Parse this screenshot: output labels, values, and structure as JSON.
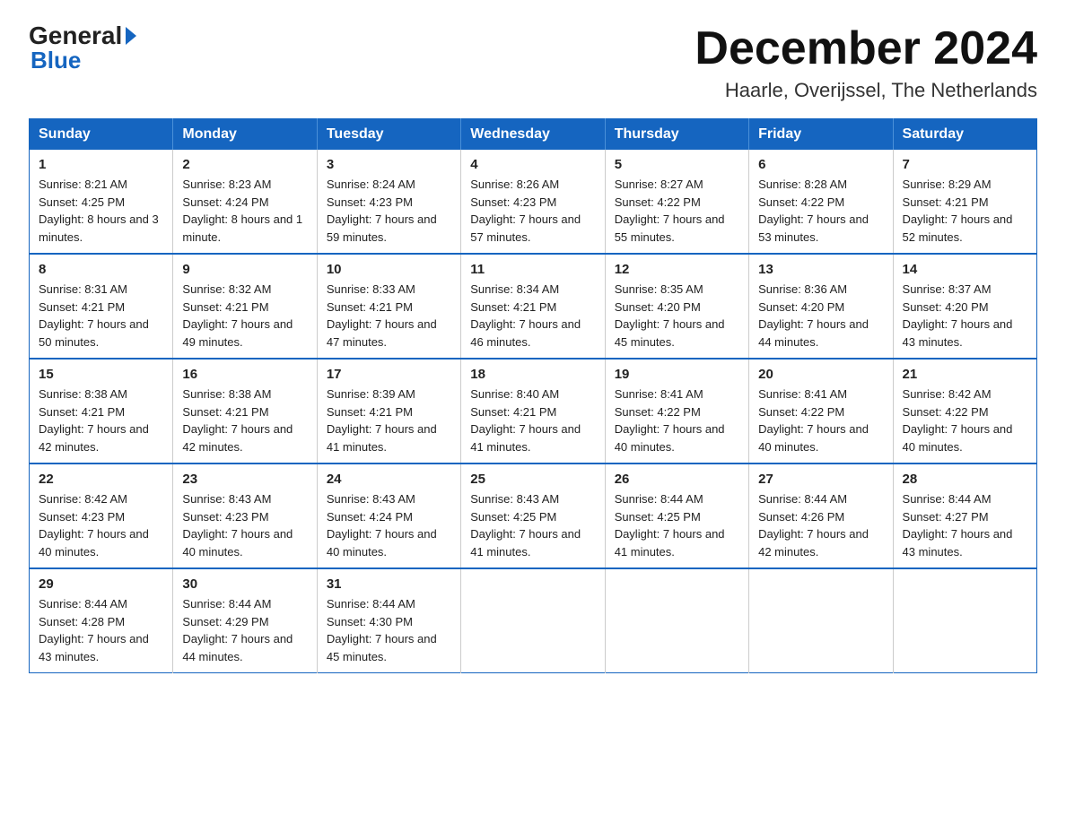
{
  "logo": {
    "general": "General",
    "blue": "Blue"
  },
  "title": "December 2024",
  "location": "Haarle, Overijssel, The Netherlands",
  "days_of_week": [
    "Sunday",
    "Monday",
    "Tuesday",
    "Wednesday",
    "Thursday",
    "Friday",
    "Saturday"
  ],
  "weeks": [
    [
      {
        "day": "1",
        "sunrise": "8:21 AM",
        "sunset": "4:25 PM",
        "daylight": "8 hours and 3 minutes."
      },
      {
        "day": "2",
        "sunrise": "8:23 AM",
        "sunset": "4:24 PM",
        "daylight": "8 hours and 1 minute."
      },
      {
        "day": "3",
        "sunrise": "8:24 AM",
        "sunset": "4:23 PM",
        "daylight": "7 hours and 59 minutes."
      },
      {
        "day": "4",
        "sunrise": "8:26 AM",
        "sunset": "4:23 PM",
        "daylight": "7 hours and 57 minutes."
      },
      {
        "day": "5",
        "sunrise": "8:27 AM",
        "sunset": "4:22 PM",
        "daylight": "7 hours and 55 minutes."
      },
      {
        "day": "6",
        "sunrise": "8:28 AM",
        "sunset": "4:22 PM",
        "daylight": "7 hours and 53 minutes."
      },
      {
        "day": "7",
        "sunrise": "8:29 AM",
        "sunset": "4:21 PM",
        "daylight": "7 hours and 52 minutes."
      }
    ],
    [
      {
        "day": "8",
        "sunrise": "8:31 AM",
        "sunset": "4:21 PM",
        "daylight": "7 hours and 50 minutes."
      },
      {
        "day": "9",
        "sunrise": "8:32 AM",
        "sunset": "4:21 PM",
        "daylight": "7 hours and 49 minutes."
      },
      {
        "day": "10",
        "sunrise": "8:33 AM",
        "sunset": "4:21 PM",
        "daylight": "7 hours and 47 minutes."
      },
      {
        "day": "11",
        "sunrise": "8:34 AM",
        "sunset": "4:21 PM",
        "daylight": "7 hours and 46 minutes."
      },
      {
        "day": "12",
        "sunrise": "8:35 AM",
        "sunset": "4:20 PM",
        "daylight": "7 hours and 45 minutes."
      },
      {
        "day": "13",
        "sunrise": "8:36 AM",
        "sunset": "4:20 PM",
        "daylight": "7 hours and 44 minutes."
      },
      {
        "day": "14",
        "sunrise": "8:37 AM",
        "sunset": "4:20 PM",
        "daylight": "7 hours and 43 minutes."
      }
    ],
    [
      {
        "day": "15",
        "sunrise": "8:38 AM",
        "sunset": "4:21 PM",
        "daylight": "7 hours and 42 minutes."
      },
      {
        "day": "16",
        "sunrise": "8:38 AM",
        "sunset": "4:21 PM",
        "daylight": "7 hours and 42 minutes."
      },
      {
        "day": "17",
        "sunrise": "8:39 AM",
        "sunset": "4:21 PM",
        "daylight": "7 hours and 41 minutes."
      },
      {
        "day": "18",
        "sunrise": "8:40 AM",
        "sunset": "4:21 PM",
        "daylight": "7 hours and 41 minutes."
      },
      {
        "day": "19",
        "sunrise": "8:41 AM",
        "sunset": "4:22 PM",
        "daylight": "7 hours and 40 minutes."
      },
      {
        "day": "20",
        "sunrise": "8:41 AM",
        "sunset": "4:22 PM",
        "daylight": "7 hours and 40 minutes."
      },
      {
        "day": "21",
        "sunrise": "8:42 AM",
        "sunset": "4:22 PM",
        "daylight": "7 hours and 40 minutes."
      }
    ],
    [
      {
        "day": "22",
        "sunrise": "8:42 AM",
        "sunset": "4:23 PM",
        "daylight": "7 hours and 40 minutes."
      },
      {
        "day": "23",
        "sunrise": "8:43 AM",
        "sunset": "4:23 PM",
        "daylight": "7 hours and 40 minutes."
      },
      {
        "day": "24",
        "sunrise": "8:43 AM",
        "sunset": "4:24 PM",
        "daylight": "7 hours and 40 minutes."
      },
      {
        "day": "25",
        "sunrise": "8:43 AM",
        "sunset": "4:25 PM",
        "daylight": "7 hours and 41 minutes."
      },
      {
        "day": "26",
        "sunrise": "8:44 AM",
        "sunset": "4:25 PM",
        "daylight": "7 hours and 41 minutes."
      },
      {
        "day": "27",
        "sunrise": "8:44 AM",
        "sunset": "4:26 PM",
        "daylight": "7 hours and 42 minutes."
      },
      {
        "day": "28",
        "sunrise": "8:44 AM",
        "sunset": "4:27 PM",
        "daylight": "7 hours and 43 minutes."
      }
    ],
    [
      {
        "day": "29",
        "sunrise": "8:44 AM",
        "sunset": "4:28 PM",
        "daylight": "7 hours and 43 minutes."
      },
      {
        "day": "30",
        "sunrise": "8:44 AM",
        "sunset": "4:29 PM",
        "daylight": "7 hours and 44 minutes."
      },
      {
        "day": "31",
        "sunrise": "8:44 AM",
        "sunset": "4:30 PM",
        "daylight": "7 hours and 45 minutes."
      },
      null,
      null,
      null,
      null
    ]
  ]
}
